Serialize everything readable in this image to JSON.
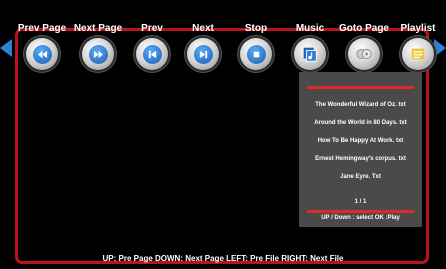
{
  "toolbar": {
    "items": [
      {
        "label": "Prev Page",
        "icon": "fast-rewind-icon"
      },
      {
        "label": "Next Page",
        "icon": "fast-forward-icon"
      },
      {
        "label": "Prev",
        "icon": "skip-previous-icon"
      },
      {
        "label": "Next",
        "icon": "skip-next-icon"
      },
      {
        "label": "Stop",
        "icon": "stop-icon"
      },
      {
        "label": "Music",
        "icon": "music-icon"
      },
      {
        "label": "Goto Page",
        "icon": "goto-page-icon"
      },
      {
        "label": "Playlist",
        "icon": "playlist-icon"
      }
    ]
  },
  "file_panel": {
    "files": [
      "The Wonderful Wizard of Oz. txt",
      "Around the World in 80 Days. txt",
      "How To Be Happy At Work. txt",
      "Ernest Hemingway's corpus. txt",
      "Jane Eyre. Txt"
    ],
    "page_indicator": "1 / 1",
    "hint": "UP / Down : select   OK :Play"
  },
  "help_line": "UP: Pre Page   DOWN: Next Page   LEFT: Pre File   RIGHT: Next File",
  "colors": {
    "frame": "#b8141c",
    "accent": "#2f7fd6",
    "panel_bg": "#4a4a4a",
    "panel_bar": "#e02828"
  }
}
